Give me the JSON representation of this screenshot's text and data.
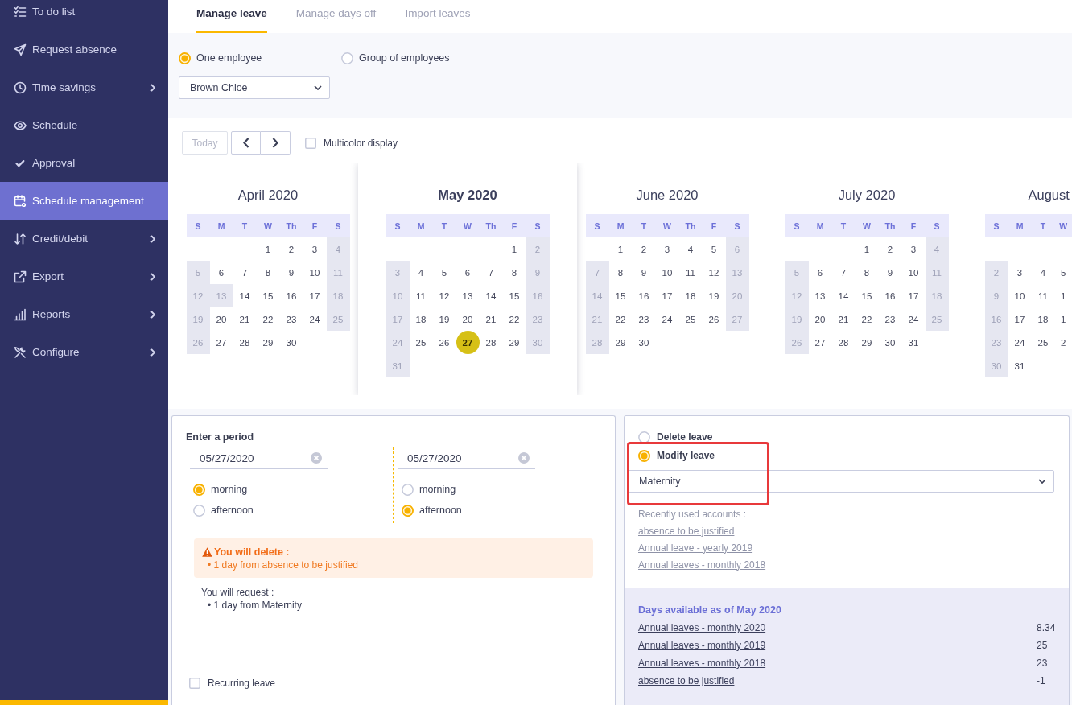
{
  "sidebar": {
    "items": [
      {
        "label": "To do list",
        "selected": false,
        "expandable": false
      },
      {
        "label": "Request absence",
        "selected": false,
        "expandable": false
      },
      {
        "label": "Time savings",
        "selected": false,
        "expandable": true
      },
      {
        "label": "Schedule",
        "selected": false,
        "expandable": false
      },
      {
        "label": "Approval",
        "selected": false,
        "expandable": false
      },
      {
        "label": "Schedule management",
        "selected": true,
        "expandable": false
      },
      {
        "label": "Credit/debit",
        "selected": false,
        "expandable": true
      },
      {
        "label": "Export",
        "selected": false,
        "expandable": true
      },
      {
        "label": "Reports",
        "selected": false,
        "expandable": true
      },
      {
        "label": "Configure",
        "selected": false,
        "expandable": true
      }
    ]
  },
  "tabs": [
    {
      "label": "Manage leave",
      "selected": true
    },
    {
      "label": "Manage days off",
      "selected": false
    },
    {
      "label": "Import leaves",
      "selected": false
    }
  ],
  "employee_filter": {
    "options": [
      {
        "label": "One employee",
        "selected": true
      },
      {
        "label": "Group of employees",
        "selected": false
      }
    ],
    "employee_select": {
      "value": "Brown Chloe"
    }
  },
  "calendar_toolbar": {
    "today_button": {
      "label": "Today",
      "disabled": true
    },
    "multicolor_display": {
      "label": "Multicolor display",
      "checked": false
    }
  },
  "months": [
    {
      "title": "April 2020",
      "selected": false,
      "weekdays": [
        "S",
        "M",
        "T",
        "W",
        "Th",
        "F",
        "S"
      ],
      "weeks": [
        [
          {
            "day": "1",
            "off": false,
            "selected": false
          },
          {
            "day": "2",
            "off": false,
            "selected": false
          },
          {
            "day": "3",
            "off": false,
            "selected": false
          },
          {
            "day": "4",
            "off": true,
            "selected": false
          }
        ],
        [
          {
            "day": "5",
            "off": true,
            "selected": false
          },
          {
            "day": "6",
            "off": false,
            "selected": false
          },
          {
            "day": "7",
            "off": false,
            "selected": false
          },
          {
            "day": "8",
            "off": false,
            "selected": false
          },
          {
            "day": "9",
            "off": false,
            "selected": false
          },
          {
            "day": "10",
            "off": false,
            "selected": false
          },
          {
            "day": "11",
            "off": true,
            "selected": false
          }
        ],
        [
          {
            "day": "12",
            "off": true,
            "selected": false
          },
          {
            "day": "13",
            "off": true,
            "selected": false
          },
          {
            "day": "14",
            "off": false,
            "selected": false
          },
          {
            "day": "15",
            "off": false,
            "selected": false
          },
          {
            "day": "16",
            "off": false,
            "selected": false
          },
          {
            "day": "17",
            "off": false,
            "selected": false
          },
          {
            "day": "18",
            "off": true,
            "selected": false
          }
        ],
        [
          {
            "day": "19",
            "off": true,
            "selected": false
          },
          {
            "day": "20",
            "off": false,
            "selected": false
          },
          {
            "day": "21",
            "off": false,
            "selected": false
          },
          {
            "day": "22",
            "off": false,
            "selected": false
          },
          {
            "day": "23",
            "off": false,
            "selected": false
          },
          {
            "day": "24",
            "off": false,
            "selected": false
          },
          {
            "day": "25",
            "off": true,
            "selected": false
          }
        ],
        [
          {
            "day": "26",
            "off": true,
            "selected": false
          },
          {
            "day": "27",
            "off": false,
            "selected": false
          },
          {
            "day": "28",
            "off": false,
            "selected": false
          },
          {
            "day": "29",
            "off": false,
            "selected": false
          },
          {
            "day": "30",
            "off": false,
            "selected": false
          }
        ]
      ]
    },
    {
      "title": "May 2020",
      "selected": true,
      "weekdays": [
        "S",
        "M",
        "T",
        "W",
        "Th",
        "F",
        "S"
      ],
      "weeks": [
        [
          {
            "day": "1",
            "off": false,
            "selected": false
          },
          {
            "day": "2",
            "off": true,
            "selected": false
          }
        ],
        [
          {
            "day": "3",
            "off": true,
            "selected": false
          },
          {
            "day": "4",
            "off": false,
            "selected": false
          },
          {
            "day": "5",
            "off": false,
            "selected": false
          },
          {
            "day": "6",
            "off": false,
            "selected": false
          },
          {
            "day": "7",
            "off": false,
            "selected": false
          },
          {
            "day": "8",
            "off": false,
            "selected": false
          },
          {
            "day": "9",
            "off": true,
            "selected": false
          }
        ],
        [
          {
            "day": "10",
            "off": true,
            "selected": false
          },
          {
            "day": "11",
            "off": false,
            "selected": false
          },
          {
            "day": "12",
            "off": false,
            "selected": false
          },
          {
            "day": "13",
            "off": false,
            "selected": false
          },
          {
            "day": "14",
            "off": false,
            "selected": false
          },
          {
            "day": "15",
            "off": false,
            "selected": false
          },
          {
            "day": "16",
            "off": true,
            "selected": false
          }
        ],
        [
          {
            "day": "17",
            "off": true,
            "selected": false
          },
          {
            "day": "18",
            "off": false,
            "selected": false
          },
          {
            "day": "19",
            "off": false,
            "selected": false
          },
          {
            "day": "20",
            "off": false,
            "selected": false
          },
          {
            "day": "21",
            "off": false,
            "selected": false
          },
          {
            "day": "22",
            "off": false,
            "selected": false
          },
          {
            "day": "23",
            "off": true,
            "selected": false
          }
        ],
        [
          {
            "day": "24",
            "off": true,
            "selected": false
          },
          {
            "day": "25",
            "off": false,
            "selected": false
          },
          {
            "day": "26",
            "off": false,
            "selected": false
          },
          {
            "day": "27",
            "off": false,
            "selected": true
          },
          {
            "day": "28",
            "off": false,
            "selected": false
          },
          {
            "day": "29",
            "off": false,
            "selected": false
          },
          {
            "day": "30",
            "off": true,
            "selected": false
          }
        ],
        [
          {
            "day": "31",
            "off": true,
            "selected": false
          }
        ]
      ]
    },
    {
      "title": "June 2020",
      "selected": false,
      "weekdays": [
        "S",
        "M",
        "T",
        "W",
        "Th",
        "F",
        "S"
      ],
      "weeks": [
        [
          {
            "day": "1",
            "off": false,
            "selected": false
          },
          {
            "day": "2",
            "off": false,
            "selected": false
          },
          {
            "day": "3",
            "off": false,
            "selected": false
          },
          {
            "day": "4",
            "off": false,
            "selected": false
          },
          {
            "day": "5",
            "off": false,
            "selected": false
          },
          {
            "day": "6",
            "off": true,
            "selected": false
          }
        ],
        [
          {
            "day": "7",
            "off": true,
            "selected": false
          },
          {
            "day": "8",
            "off": false,
            "selected": false
          },
          {
            "day": "9",
            "off": false,
            "selected": false
          },
          {
            "day": "10",
            "off": false,
            "selected": false
          },
          {
            "day": "11",
            "off": false,
            "selected": false
          },
          {
            "day": "12",
            "off": false,
            "selected": false
          },
          {
            "day": "13",
            "off": true,
            "selected": false
          }
        ],
        [
          {
            "day": "14",
            "off": true,
            "selected": false
          },
          {
            "day": "15",
            "off": false,
            "selected": false
          },
          {
            "day": "16",
            "off": false,
            "selected": false
          },
          {
            "day": "17",
            "off": false,
            "selected": false
          },
          {
            "day": "18",
            "off": false,
            "selected": false
          },
          {
            "day": "19",
            "off": false,
            "selected": false
          },
          {
            "day": "20",
            "off": true,
            "selected": false
          }
        ],
        [
          {
            "day": "21",
            "off": true,
            "selected": false
          },
          {
            "day": "22",
            "off": false,
            "selected": false
          },
          {
            "day": "23",
            "off": false,
            "selected": false
          },
          {
            "day": "24",
            "off": false,
            "selected": false
          },
          {
            "day": "25",
            "off": false,
            "selected": false
          },
          {
            "day": "26",
            "off": false,
            "selected": false
          },
          {
            "day": "27",
            "off": true,
            "selected": false
          }
        ],
        [
          {
            "day": "28",
            "off": true,
            "selected": false
          },
          {
            "day": "29",
            "off": false,
            "selected": false
          },
          {
            "day": "30",
            "off": false,
            "selected": false
          }
        ]
      ]
    },
    {
      "title": "July 2020",
      "selected": false,
      "weekdays": [
        "S",
        "M",
        "T",
        "W",
        "Th",
        "F",
        "S"
      ],
      "weeks": [
        [
          {
            "day": "1",
            "off": false,
            "selected": false
          },
          {
            "day": "2",
            "off": false,
            "selected": false
          },
          {
            "day": "3",
            "off": false,
            "selected": false
          },
          {
            "day": "4",
            "off": true,
            "selected": false
          }
        ],
        [
          {
            "day": "5",
            "off": true,
            "selected": false
          },
          {
            "day": "6",
            "off": false,
            "selected": false
          },
          {
            "day": "7",
            "off": false,
            "selected": false
          },
          {
            "day": "8",
            "off": false,
            "selected": false
          },
          {
            "day": "9",
            "off": false,
            "selected": false
          },
          {
            "day": "10",
            "off": false,
            "selected": false
          },
          {
            "day": "11",
            "off": true,
            "selected": false
          }
        ],
        [
          {
            "day": "12",
            "off": true,
            "selected": false
          },
          {
            "day": "13",
            "off": false,
            "selected": false
          },
          {
            "day": "14",
            "off": false,
            "selected": false
          },
          {
            "day": "15",
            "off": false,
            "selected": false
          },
          {
            "day": "16",
            "off": false,
            "selected": false
          },
          {
            "day": "17",
            "off": false,
            "selected": false
          },
          {
            "day": "18",
            "off": true,
            "selected": false
          }
        ],
        [
          {
            "day": "19",
            "off": true,
            "selected": false
          },
          {
            "day": "20",
            "off": false,
            "selected": false
          },
          {
            "day": "21",
            "off": false,
            "selected": false
          },
          {
            "day": "22",
            "off": false,
            "selected": false
          },
          {
            "day": "23",
            "off": false,
            "selected": false
          },
          {
            "day": "24",
            "off": false,
            "selected": false
          },
          {
            "day": "25",
            "off": true,
            "selected": false
          }
        ],
        [
          {
            "day": "26",
            "off": true,
            "selected": false
          },
          {
            "day": "27",
            "off": false,
            "selected": false
          },
          {
            "day": "28",
            "off": false,
            "selected": false
          },
          {
            "day": "29",
            "off": false,
            "selected": false
          },
          {
            "day": "30",
            "off": false,
            "selected": false
          },
          {
            "day": "31",
            "off": false,
            "selected": false
          }
        ]
      ]
    },
    {
      "title": "August",
      "selected": false,
      "leading_blank_row": true,
      "weekdays": [
        "S",
        "M",
        "T",
        "W"
      ],
      "weeks": [
        [
          {
            "day": "2",
            "off": true,
            "selected": false
          },
          {
            "day": "3",
            "off": false,
            "selected": false
          },
          {
            "day": "4",
            "off": false,
            "selected": false
          },
          {
            "day": "5",
            "off": false,
            "selected": false
          }
        ],
        [
          {
            "day": "9",
            "off": true,
            "selected": false
          },
          {
            "day": "10",
            "off": false,
            "selected": false
          },
          {
            "day": "11",
            "off": false,
            "selected": false
          },
          {
            "day": "1",
            "off": false,
            "selected": false
          }
        ],
        [
          {
            "day": "16",
            "off": true,
            "selected": false
          },
          {
            "day": "17",
            "off": false,
            "selected": false
          },
          {
            "day": "18",
            "off": false,
            "selected": false
          },
          {
            "day": "1",
            "off": false,
            "selected": false
          }
        ],
        [
          {
            "day": "23",
            "off": true,
            "selected": false
          },
          {
            "day": "24",
            "off": false,
            "selected": false
          },
          {
            "day": "25",
            "off": false,
            "selected": false
          },
          {
            "day": "2",
            "off": false,
            "selected": false
          }
        ],
        [
          {
            "day": "30",
            "off": true,
            "selected": false
          },
          {
            "day": "31",
            "off": false,
            "selected": false
          }
        ]
      ]
    }
  ],
  "period": {
    "title": "Enter a period",
    "ends": [
      {
        "date": "05/27/2020",
        "half_days": [
          {
            "label": "morning",
            "selected": true
          },
          {
            "label": "afternoon",
            "selected": false
          }
        ]
      },
      {
        "date": "05/27/2020",
        "half_days": [
          {
            "label": "morning",
            "selected": false
          },
          {
            "label": "afternoon",
            "selected": true
          }
        ]
      }
    ],
    "warning": {
      "title": "You will delete :",
      "items": [
        "• 1 day from absence to be justified"
      ]
    },
    "request": {
      "title": "You will request :",
      "items": [
        "• 1 day from Maternity"
      ]
    },
    "recurring_leave": {
      "label": "Recurring leave",
      "checked": false
    }
  },
  "leave_action": {
    "options": [
      {
        "label": "Delete leave",
        "selected": false
      },
      {
        "label": "Modify leave",
        "selected": true
      }
    ],
    "highlight": true,
    "leave_type_select": {
      "value": "Maternity"
    },
    "recent_accounts": {
      "title": "Recently used accounts :",
      "links": [
        "absence to be justified",
        "Annual leave - yearly 2019",
        "Annual leaves - monthly 2018"
      ]
    }
  },
  "days_available": {
    "title": "Days available as of May 2020",
    "rows": [
      {
        "account": "Annual leaves - monthly 2020",
        "days": "8.34"
      },
      {
        "account": "Annual leaves - monthly 2019",
        "days": "25"
      },
      {
        "account": "Annual leaves - monthly 2018",
        "days": "23"
      },
      {
        "account": "absence to be justified",
        "days": "-1"
      }
    ]
  }
}
